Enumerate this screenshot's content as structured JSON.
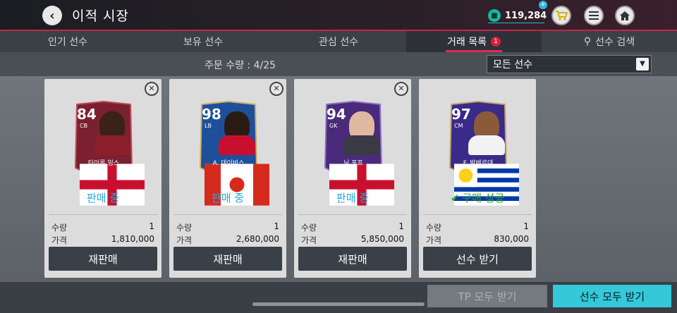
{
  "header": {
    "title": "이적 시장",
    "coin_value": "119,284",
    "icons": [
      "back-arrow-icon",
      "shirt-coin-icon",
      "cart-icon",
      "list-icon",
      "home-icon"
    ]
  },
  "tabs": [
    {
      "label": "인기 선수"
    },
    {
      "label": "보유 선수"
    },
    {
      "label": "관심 선수"
    },
    {
      "label": "거래 목록",
      "badge": "1"
    },
    {
      "label": "선수 검색"
    }
  ],
  "order": {
    "text": "주문 수량 : 4/25",
    "filter_value": "모든 선수"
  },
  "cards": [
    {
      "rating": "84",
      "position": "CB",
      "name": "타이론 밍스",
      "status": "판매 중",
      "status_type": "selling",
      "qty_label": "수량",
      "qty": "1",
      "price_label": "가격",
      "price": "1,810,000",
      "button": "재판매",
      "has_close": true,
      "card_color": "#7a2030",
      "card_accent": "#c24a5a"
    },
    {
      "rating": "98",
      "position": "LB",
      "name": "A. 데이비스",
      "status": "판매 중",
      "status_type": "selling",
      "qty_label": "수량",
      "qty": "1",
      "price_label": "가격",
      "price": "2,680,000",
      "button": "재판매",
      "has_close": true,
      "card_color": "#1e4f9a",
      "card_accent": "#d0b060"
    },
    {
      "rating": "94",
      "position": "GK",
      "name": "닉 포프",
      "status": "판매 중",
      "status_type": "selling",
      "qty_label": "수량",
      "qty": "1",
      "price_label": "가격",
      "price": "5,850,000",
      "button": "재판매",
      "has_close": true,
      "card_color": "#4a2a7a",
      "card_accent": "#9070c0"
    },
    {
      "rating": "97",
      "position": "CM",
      "name": "F. 발베르데",
      "status": "구매 성공",
      "status_type": "success",
      "qty_label": "수량",
      "qty": "1",
      "price_label": "가격",
      "price": "830,000",
      "button": "선수 받기",
      "has_close": false,
      "card_color": "#3a2a8a",
      "card_accent": "#c8a860"
    }
  ],
  "bottom": {
    "tp_button": "TP 모두 받기",
    "collect_button": "선수 모두 받기"
  }
}
